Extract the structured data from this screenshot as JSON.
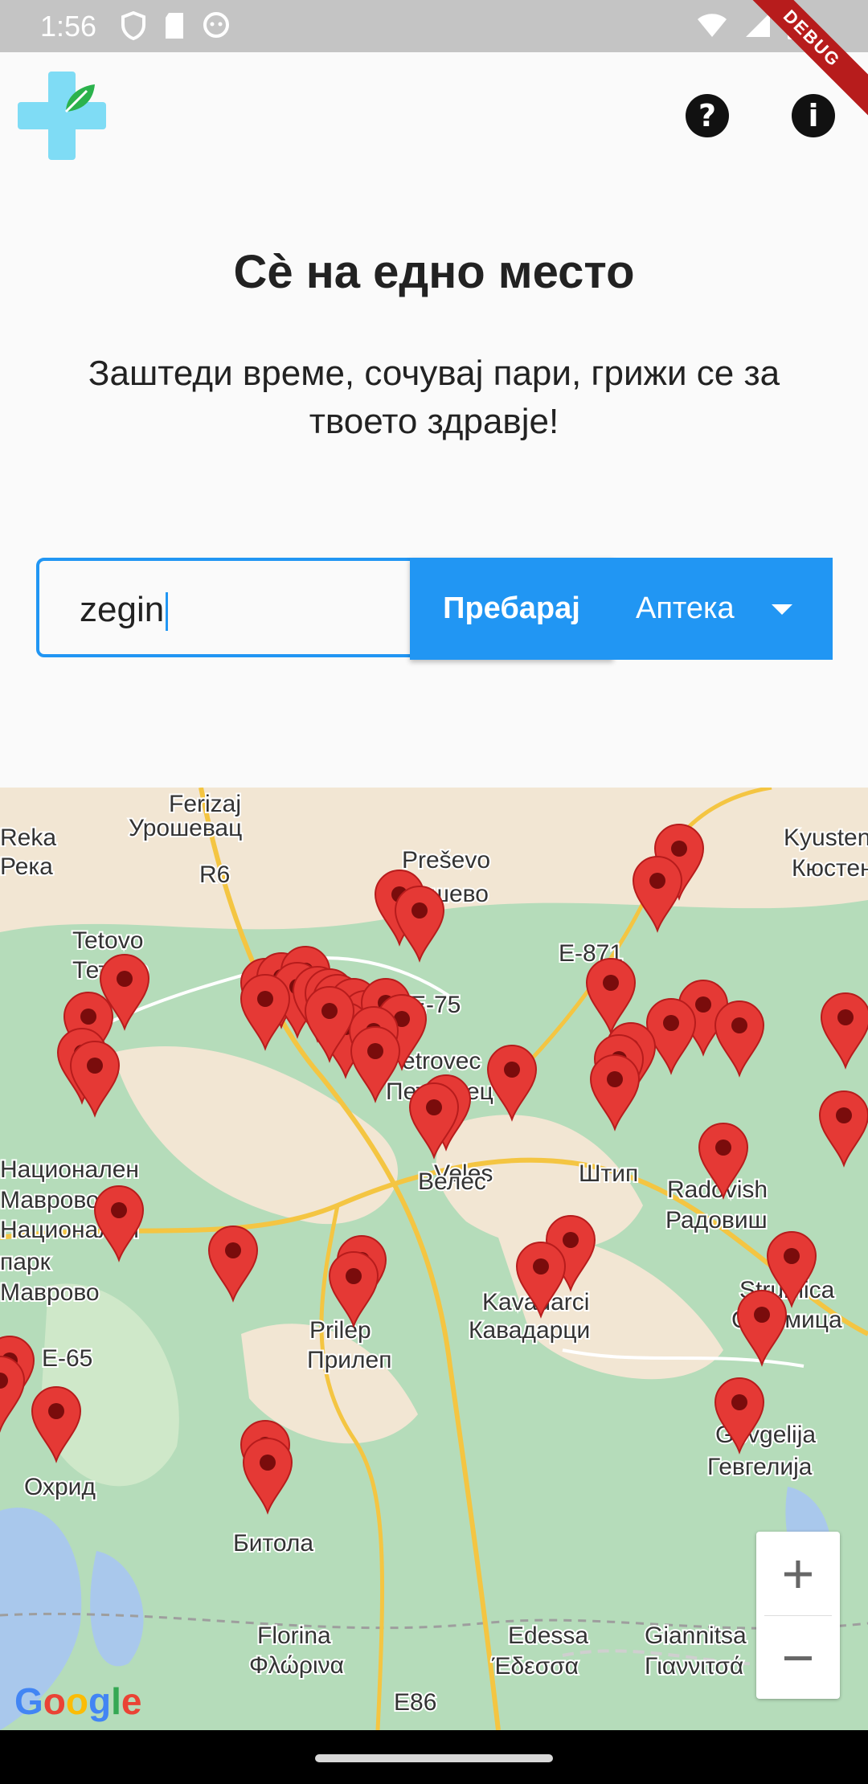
{
  "status_bar": {
    "time": "1:56"
  },
  "debug_banner": "DEBUG",
  "header": {
    "title": "Сè на едно место",
    "subtitle": "Заштеди време, сочувај пари, грижи се за твоето здравје!"
  },
  "search": {
    "value": "zegin",
    "button_label": "Пребарај",
    "type_selected": "Аптека"
  },
  "colors": {
    "accent": "#2196F3",
    "pin": "#E53935",
    "map_land": "#a8d8b0",
    "map_road": "#f4c542"
  },
  "map": {
    "labels": [
      "Ferizaj",
      "Урошевац",
      "Reka",
      "Река",
      "R6",
      "Preševo",
      "Прешево",
      "Kyustendil",
      "Кюстенди",
      "Tetovo",
      "Тетово",
      "E-871",
      "Petrovec",
      "Петровец",
      "Национален",
      "Маврово",
      "Национален",
      "парк",
      "Маврово",
      "Veles",
      "Велес",
      "Штип",
      "Radovish",
      "Радовиш",
      "E-65",
      "Kavadarci",
      "Кавадарци",
      "Strumica",
      "Струмица",
      "Prilep",
      "Прилеп",
      "Охрид",
      "Gevgelija",
      "Гевгелија",
      "Битола",
      "Florina",
      "Φλώρινα",
      "Edessa",
      "Έδεσσα",
      "Giannitsa",
      "Γιαννιτσά",
      "E86",
      "E-75"
    ]
  },
  "google_logo": "Google"
}
